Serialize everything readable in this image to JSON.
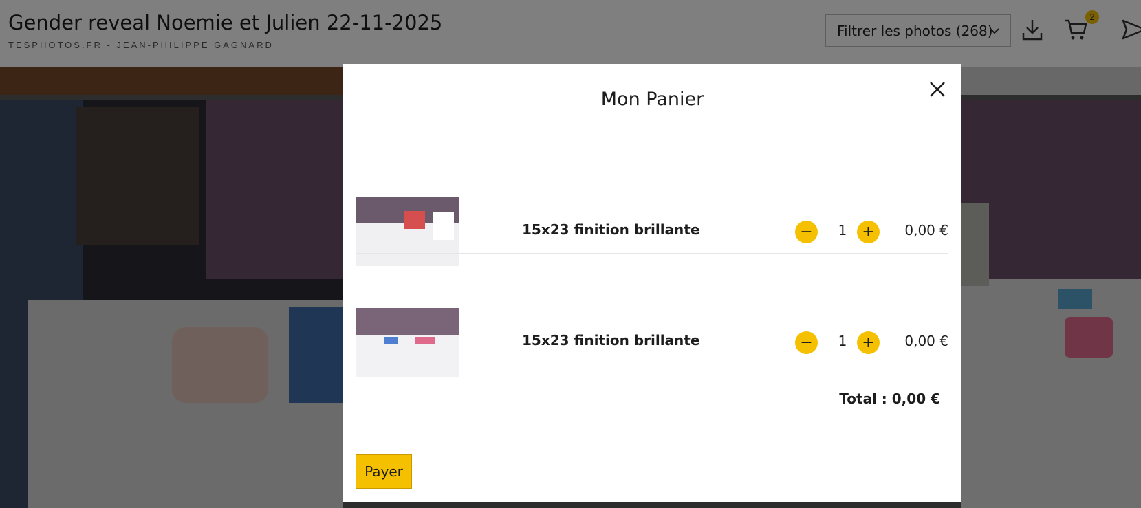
{
  "header": {
    "title": "Gender reveal Noemie et Julien 22-11-2025",
    "subtitle": "TESPHOTOS.FR - JEAN-PHILIPPE GAGNARD",
    "filter_label": "Filtrer les photos (268)",
    "cart_count": "2",
    "icons": [
      "chevron-down-icon",
      "download-icon",
      "cart-icon",
      "send-icon"
    ]
  },
  "modal": {
    "title": "Mon Panier",
    "close_icon": "close-icon",
    "items": [
      {
        "label": "15x23 finition brillante",
        "minus": "−",
        "quantity": "1",
        "plus": "+",
        "price": "0,00 €"
      },
      {
        "label": "15x23 finition brillante",
        "minus": "−",
        "quantity": "1",
        "plus": "+",
        "price": "0,00 €"
      }
    ],
    "total": "Total : 0,00 €",
    "pay_label": "Payer"
  },
  "colors": {
    "accent": "#f5c000",
    "overlay": "rgba(0,0,0,0.5)",
    "text": "#1d1d1d"
  }
}
